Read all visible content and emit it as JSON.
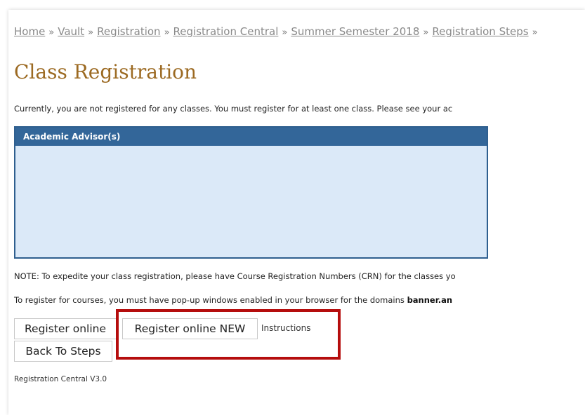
{
  "breadcrumb": {
    "items": [
      "Home",
      "Vault",
      "Registration",
      "Registration Central",
      "Summer Semester 2018",
      "Registration Steps"
    ],
    "separator": "»"
  },
  "page": {
    "title": "Class Registration",
    "intro": "Currently, you are not registered for any classes. You must register for at least one class. Please see your ac"
  },
  "advisor_panel": {
    "header": "Academic Advisor(s)"
  },
  "notes": {
    "crn_note": "NOTE: To expedite your class registration, please have Course Registration Numbers (CRN) for the classes yo",
    "popup_prefix": "To register for courses, you must have pop-up windows enabled in your browser for the domains ",
    "popup_domain": "banner.an"
  },
  "actions": {
    "register_online": "Register online",
    "register_online_new": "Register online NEW",
    "instructions": "Instructions",
    "back_to_steps": "Back To Steps"
  },
  "footer": {
    "version": "Registration Central V3.0"
  },
  "colors": {
    "title": "#9c6a22",
    "panel_header": "#336699",
    "panel_body": "#dbe9f8",
    "highlight": "#b50d0d",
    "link": "#8a8a8a"
  }
}
